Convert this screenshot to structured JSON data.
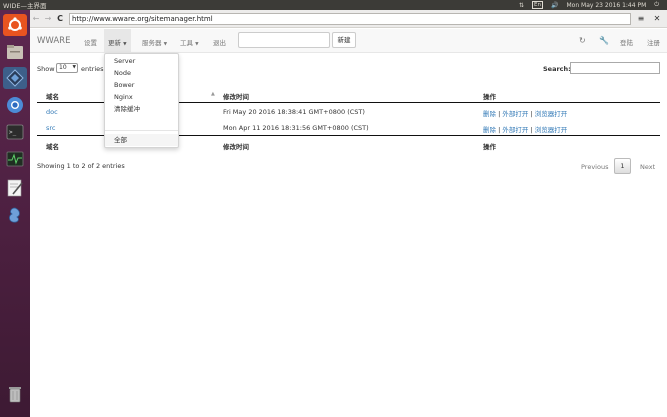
{
  "top_panel": {
    "window_title": "WIDE—主界面",
    "keyboard_layout": "En",
    "datetime": "Mon May 23 2016  1:44 PM"
  },
  "launcher": {
    "items": [
      {
        "icon": "ubuntu-dash-icon"
      },
      {
        "icon": "files-icon"
      },
      {
        "icon": "wide-ide-icon"
      },
      {
        "icon": "chromium-browser-icon"
      },
      {
        "icon": "terminal-icon"
      },
      {
        "icon": "system-monitor-icon"
      },
      {
        "icon": "text-editor-icon"
      },
      {
        "icon": "app-icon"
      },
      {
        "icon": "trash-icon"
      }
    ]
  },
  "browser": {
    "url": "http://www.wware.org/sitemanager.html"
  },
  "navbar": {
    "brand": "WWARE",
    "settings": "设置",
    "update": "更新",
    "server": "服务器",
    "tools": "工具",
    "logout": "退出",
    "new_button": "新建",
    "login": "登陆",
    "register": "注册"
  },
  "dropdown": {
    "items": [
      "Server",
      "Node",
      "Bower",
      "Nginx",
      "清除缓冲"
    ],
    "all": "全部"
  },
  "table_controls": {
    "show_label": "Show",
    "page_size": "10",
    "entries_label": "entries",
    "search_label": "Search:"
  },
  "table": {
    "columns": [
      "域名",
      "修改时间",
      "操作"
    ],
    "rows": [
      {
        "domain": "doc",
        "modified": "Fri May 20 2016 18:38:41 GMT+0800 (CST)"
      },
      {
        "domain": "src",
        "modified": "Mon Apr 11 2016 18:31:56 GMT+0800 (CST)"
      }
    ],
    "actions": {
      "delete": "删除",
      "sep": "|",
      "open_external": "外部打开",
      "open_browser": "浏览器打开"
    }
  },
  "footer": {
    "info": "Showing 1 to 2 of 2 entries",
    "previous": "Previous",
    "page": "1",
    "next": "Next"
  },
  "colors": {
    "top_panel": "#3c3b37",
    "launcher": "#5e2750",
    "link": "#337ab7"
  }
}
